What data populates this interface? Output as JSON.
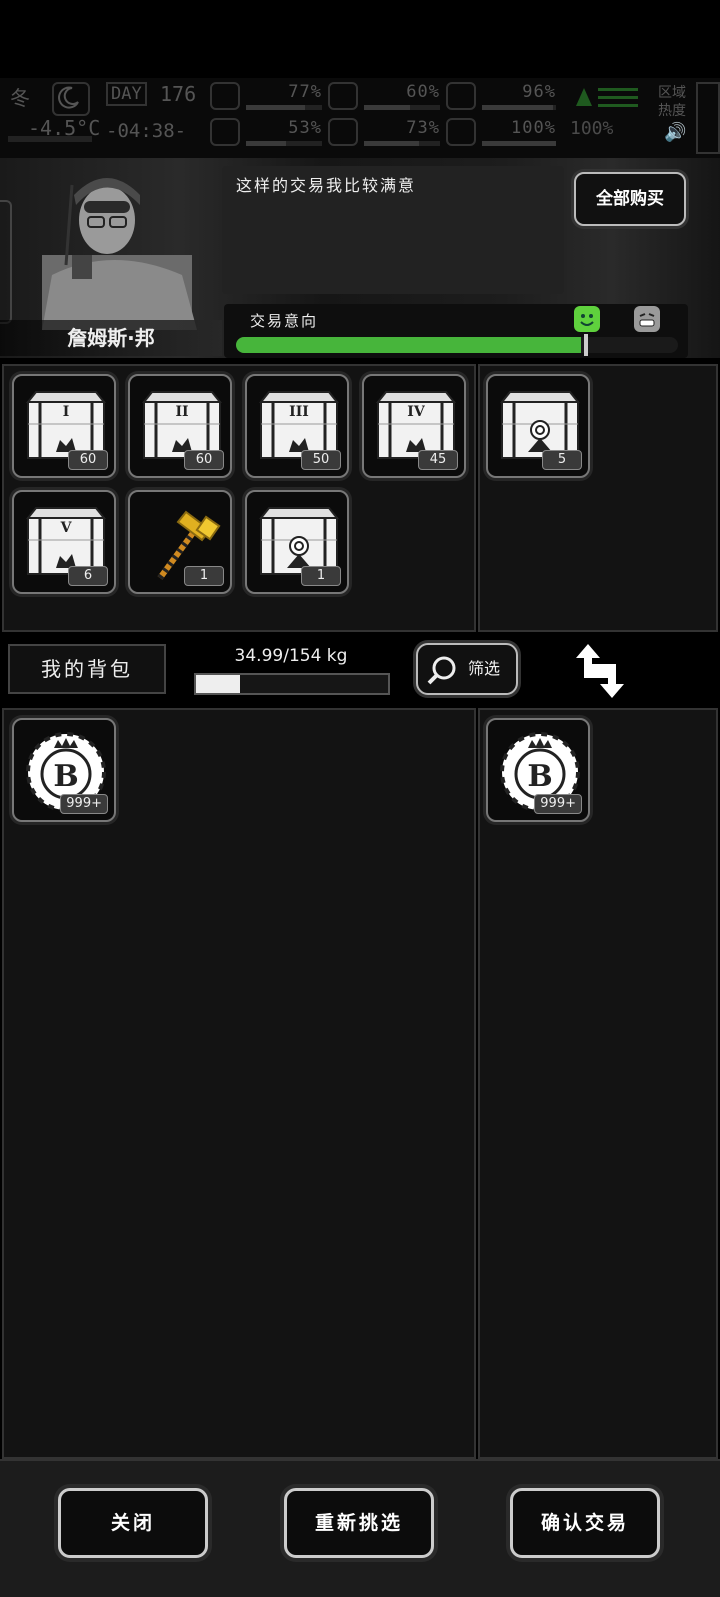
{
  "hud": {
    "season": "冬",
    "day_label": "DAY",
    "day_value": "176",
    "temperature": "-4.5°C",
    "clock": "-04:38-",
    "stats": [
      {
        "icon": "medkit-icon",
        "value": "77%",
        "fill": 0.77
      },
      {
        "icon": "stomach-icon",
        "value": "60%",
        "fill": 0.6
      },
      {
        "icon": "lungs-icon",
        "value": "96%",
        "fill": 0.96
      },
      {
        "icon": "brain-icon",
        "value": "53%",
        "fill": 0.53
      },
      {
        "icon": "water-drop-icon",
        "value": "73%",
        "fill": 0.73
      },
      {
        "icon": "heart-icon",
        "value": "100%",
        "fill": 1.0
      }
    ],
    "radiation_value": "100%",
    "zone_heat_label": "区域热度"
  },
  "npc": {
    "name": "詹姆斯·邦",
    "dialog": "这样的交易我比较满意",
    "buy_all_label": "全部购买",
    "intent_label": "交易意向",
    "intent_level": 0.78
  },
  "trade_panel_left": {
    "items": [
      {
        "name": "crate-i",
        "roman": "I",
        "count": "60",
        "kind": "crate"
      },
      {
        "name": "crate-ii",
        "roman": "II",
        "count": "60",
        "kind": "crate"
      },
      {
        "name": "crate-iii",
        "roman": "III",
        "count": "50",
        "kind": "crate"
      },
      {
        "name": "crate-iv",
        "roman": "IV",
        "count": "45",
        "kind": "crate"
      },
      {
        "name": "crate-v",
        "roman": "V",
        "count": "6",
        "kind": "crate"
      },
      {
        "name": "golden-hammer",
        "roman": "",
        "count": "1",
        "kind": "hammer"
      },
      {
        "name": "crate-special",
        "roman": "",
        "count": "1",
        "kind": "crate-special"
      }
    ]
  },
  "trade_panel_right": {
    "items": [
      {
        "name": "crate-special",
        "roman": "",
        "count": "5",
        "kind": "crate-special"
      }
    ]
  },
  "inventory": {
    "bag_label": "我的背包",
    "weight_text": "34.99/154 kg",
    "weight_fill": 0.227,
    "filter_label": "筛选"
  },
  "bag_left": {
    "items": [
      {
        "name": "coin",
        "count": "999+"
      }
    ]
  },
  "bag_right": {
    "items": [
      {
        "name": "coin",
        "count": "999+"
      }
    ]
  },
  "buttons": {
    "close": "关闭",
    "reselect": "重新挑选",
    "confirm": "确认交易"
  },
  "colors": {
    "intent_green": "#47b53b",
    "gold": "#e0b020"
  }
}
